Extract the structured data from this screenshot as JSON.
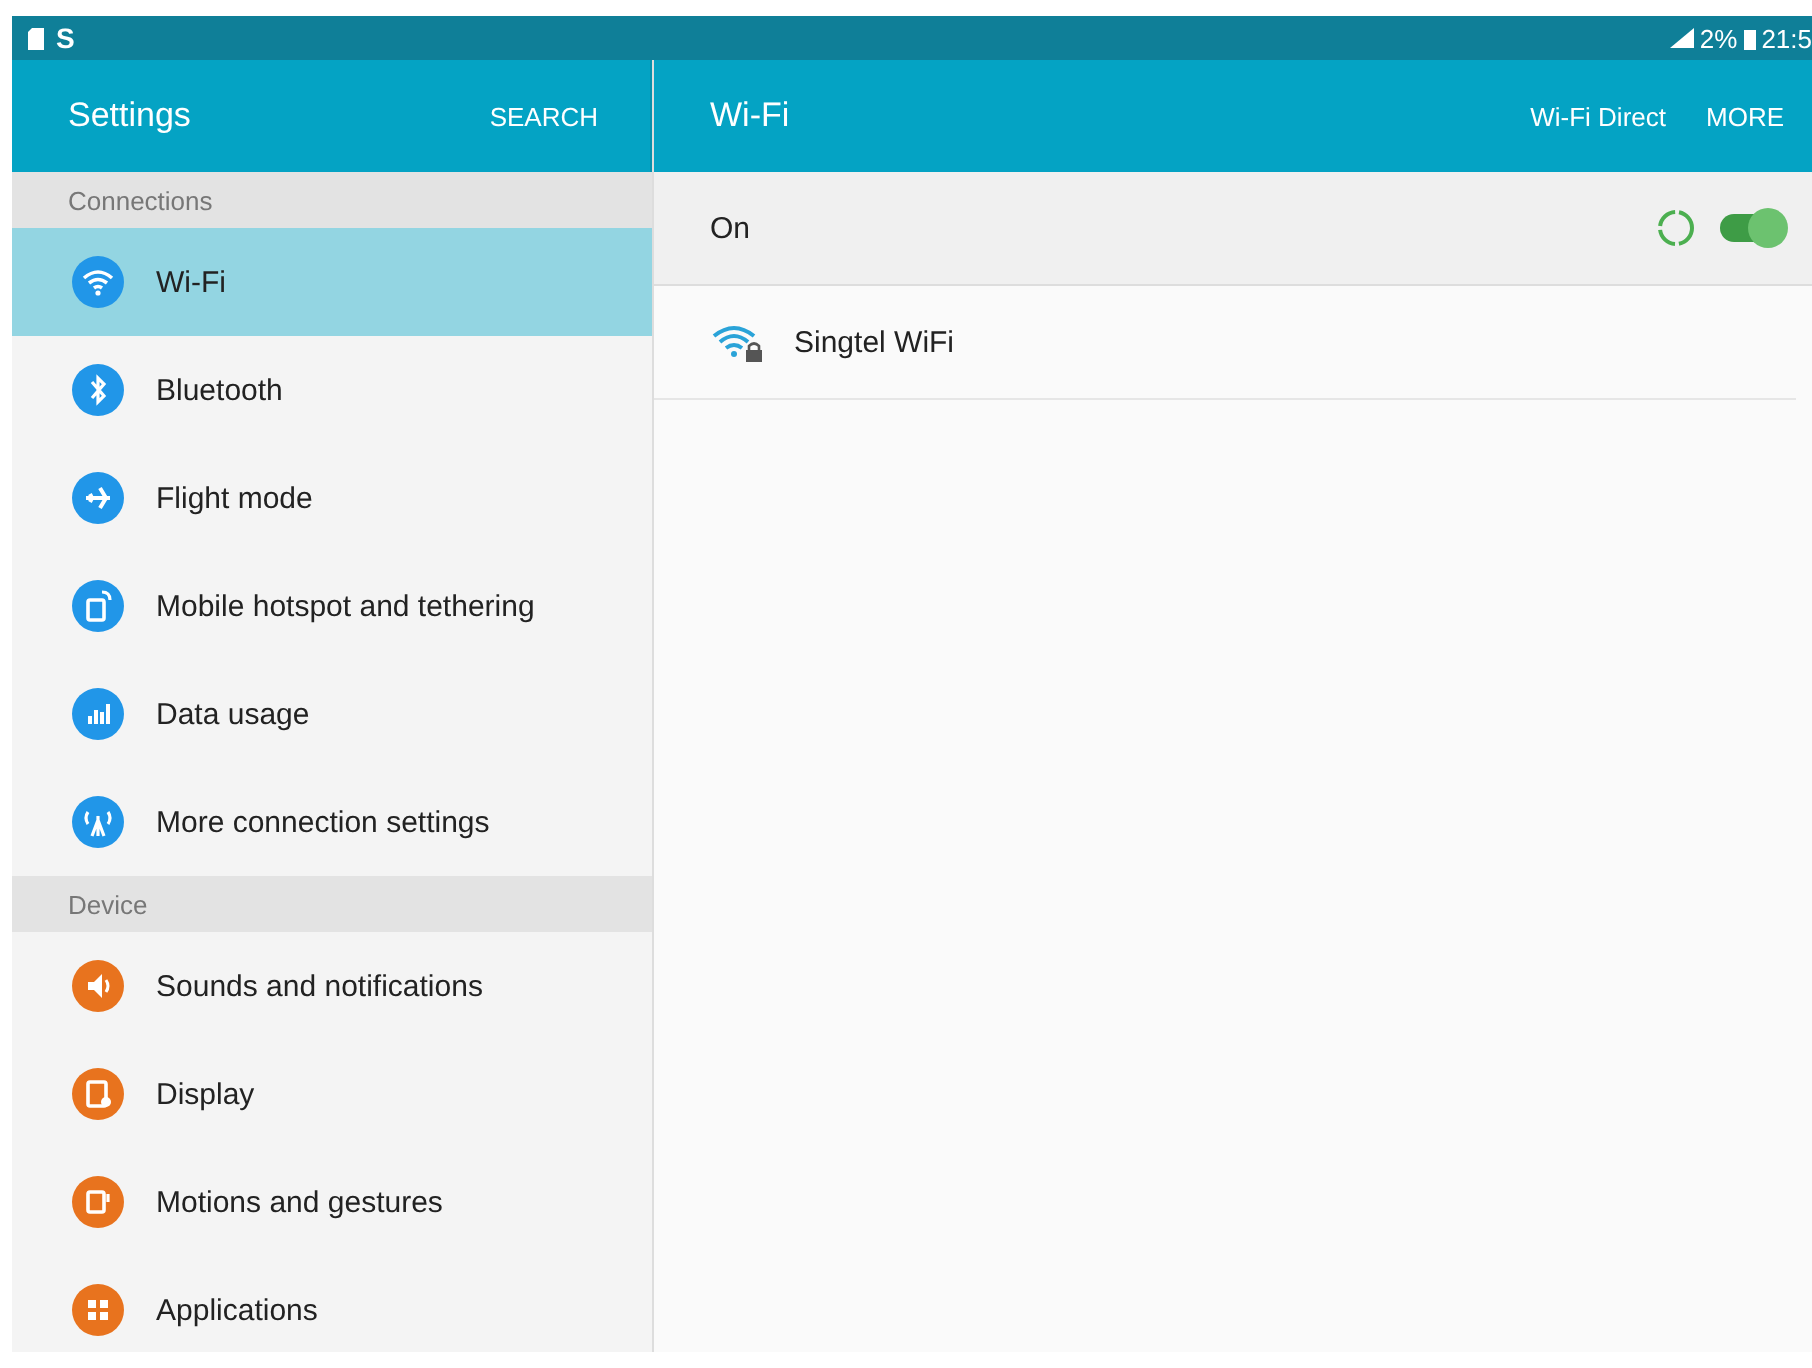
{
  "status_bar": {
    "left_icons": [
      "S"
    ],
    "signal": "2%",
    "time": "21:5"
  },
  "sidebar": {
    "title": "Settings",
    "search": "SEARCH",
    "sections": [
      {
        "header": "Connections",
        "items": [
          {
            "label": "Wi-Fi",
            "kind": "wifi",
            "color": "#2196e8",
            "selected": true
          },
          {
            "label": "Bluetooth",
            "kind": "bluetooth",
            "color": "#2196e8",
            "selected": false
          },
          {
            "label": "Flight mode",
            "kind": "plane",
            "color": "#2196e8",
            "selected": false
          },
          {
            "label": "Mobile hotspot and tethering",
            "kind": "hotspot",
            "color": "#2196e8",
            "selected": false
          },
          {
            "label": "Data usage",
            "kind": "bars",
            "color": "#2196e8",
            "selected": false
          },
          {
            "label": "More connection settings",
            "kind": "antenna",
            "color": "#2196e8",
            "selected": false
          }
        ]
      },
      {
        "header": "Device",
        "items": [
          {
            "label": "Sounds and notifications",
            "kind": "speaker",
            "color": "#e8731e",
            "selected": false
          },
          {
            "label": "Display",
            "kind": "display",
            "color": "#e8731e",
            "selected": false
          },
          {
            "label": "Motions and gestures",
            "kind": "motion",
            "color": "#e8731e",
            "selected": false
          },
          {
            "label": "Applications",
            "kind": "apps",
            "color": "#e8731e",
            "selected": false
          }
        ]
      }
    ]
  },
  "main": {
    "title": "Wi-Fi",
    "actions": [
      "Wi-Fi Direct",
      "MORE"
    ],
    "switch_label": "On",
    "on": true,
    "scanning": true,
    "networks": [
      {
        "name": "Singtel WiFi",
        "secured": true
      }
    ]
  }
}
